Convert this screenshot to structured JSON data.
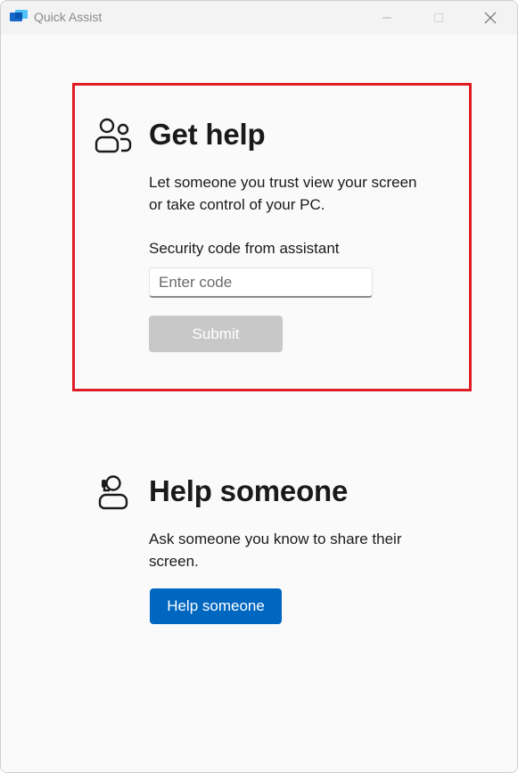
{
  "window": {
    "title": "Quick Assist",
    "app_icon": "quick-assist-icon"
  },
  "get_help": {
    "icon": "people-icon",
    "title": "Get help",
    "description_line1": "Let someone you trust view your screen",
    "description_line2": "or take control of your PC.",
    "code_label": "Security code from assistant",
    "code_input": {
      "value": "",
      "placeholder": "Enter code"
    },
    "submit_label": "Submit"
  },
  "help_someone": {
    "icon": "person-headset-icon",
    "title": "Help someone",
    "description_line1": "Ask someone you know to share their",
    "description_line2": "screen.",
    "button_label": "Help someone"
  },
  "colors": {
    "primary_button": "#0067c0",
    "disabled_button": "#c8c8c8",
    "highlight_border": "#e01b24"
  }
}
